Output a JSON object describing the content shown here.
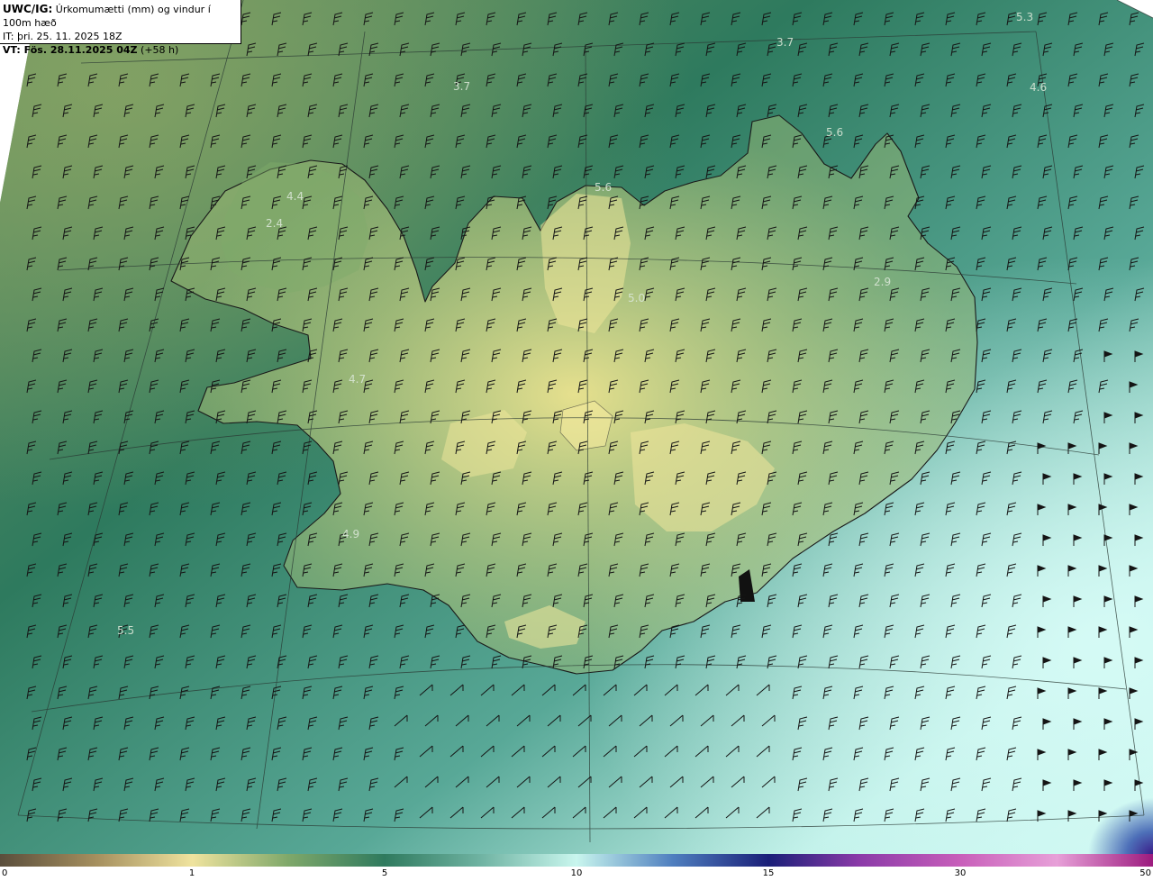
{
  "header": {
    "model": "UWC/IG:",
    "title": "Úrkomumætti (mm) og vindur í 100m hæð",
    "init_time": "IT: þri. 25. 11. 2025 18Z",
    "valid_label": "VT: Fös. 28.11.2025 04Z",
    "lead": "(+58 h)"
  },
  "map_labels": [
    {
      "id": "lbl-1",
      "text": "5.3"
    },
    {
      "id": "lbl-2",
      "text": "3.7"
    },
    {
      "id": "lbl-3",
      "text": "3.7"
    },
    {
      "id": "lbl-4",
      "text": "4.6"
    },
    {
      "id": "lbl-5",
      "text": "5.6"
    },
    {
      "id": "lbl-6",
      "text": "5.6"
    },
    {
      "id": "lbl-7",
      "text": "4.4"
    },
    {
      "id": "lbl-8",
      "text": "2.4"
    },
    {
      "id": "lbl-9",
      "text": "5.0"
    },
    {
      "id": "lbl-10",
      "text": "2.9"
    },
    {
      "id": "lbl-11",
      "text": "4.7"
    },
    {
      "id": "lbl-12",
      "text": "4.9"
    },
    {
      "id": "lbl-13",
      "text": "5.5"
    }
  ],
  "colorbar": {
    "ticks": [
      "0",
      "1",
      "5",
      "10",
      "15",
      "30",
      "50"
    ],
    "stops": [
      {
        "v": 0,
        "c": "#5a4e3c"
      },
      {
        "v": 0.5,
        "c": "#a58f5e"
      },
      {
        "v": 1,
        "c": "#efe39e"
      },
      {
        "v": 3,
        "c": "#7fa86a"
      },
      {
        "v": 5,
        "c": "#2f7a5e"
      },
      {
        "v": 7.5,
        "c": "#6fb3a2"
      },
      {
        "v": 10,
        "c": "#c9f6ee"
      },
      {
        "v": 12.5,
        "c": "#4f7fbf"
      },
      {
        "v": 15,
        "c": "#1a1f78"
      },
      {
        "v": 22,
        "c": "#8a3aa8"
      },
      {
        "v": 30,
        "c": "#c85fba"
      },
      {
        "v": 40,
        "c": "#e7a0d8"
      },
      {
        "v": 50,
        "c": "#9c1b7e"
      }
    ]
  }
}
